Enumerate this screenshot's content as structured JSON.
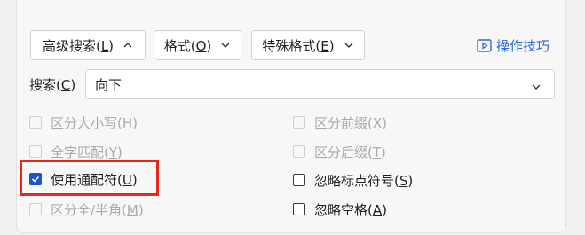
{
  "toolbar": {
    "advanced": {
      "label": "高级搜索(",
      "accel": "L",
      "close": ")"
    },
    "format": {
      "label": "格式(",
      "accel": "O",
      "close": ")"
    },
    "special": {
      "label": "特殊格式(",
      "accel": "E",
      "close": ")"
    },
    "tips_label": "操作技巧"
  },
  "search": {
    "label": "搜索(",
    "accel": "C",
    "close": ")",
    "direction_value": "向下"
  },
  "options_left": [
    {
      "label": "区分大小写(",
      "accel": "H",
      "close": ")",
      "checked": false,
      "disabled": true
    },
    {
      "label": "全字匹配(",
      "accel": "Y",
      "close": ")",
      "checked": false,
      "disabled": true
    },
    {
      "label": "使用通配符(",
      "accel": "U",
      "close": ")",
      "checked": true,
      "disabled": false
    },
    {
      "label": "区分全/半角(",
      "accel": "M",
      "close": ")",
      "checked": false,
      "disabled": true
    }
  ],
  "options_right": [
    {
      "label": "区分前缀(",
      "accel": "X",
      "close": ")",
      "checked": false,
      "disabled": true
    },
    {
      "label": "区分后缀(",
      "accel": "T",
      "close": ")",
      "checked": false,
      "disabled": true
    },
    {
      "label": "忽略标点符号(",
      "accel": "S",
      "close": ")",
      "checked": false,
      "disabled": false
    },
    {
      "label": "忽略空格(",
      "accel": "A",
      "close": ")",
      "checked": false,
      "disabled": false
    }
  ],
  "colors": {
    "accent": "#2d6bd3",
    "checkbox_checked": "#1a56c8",
    "highlight": "#e8261b",
    "disabled_text": "#a9a9a9"
  },
  "icons": [
    "chevron-up-icon",
    "chevron-down-icon",
    "play-tips-icon",
    "checkmark-icon"
  ]
}
